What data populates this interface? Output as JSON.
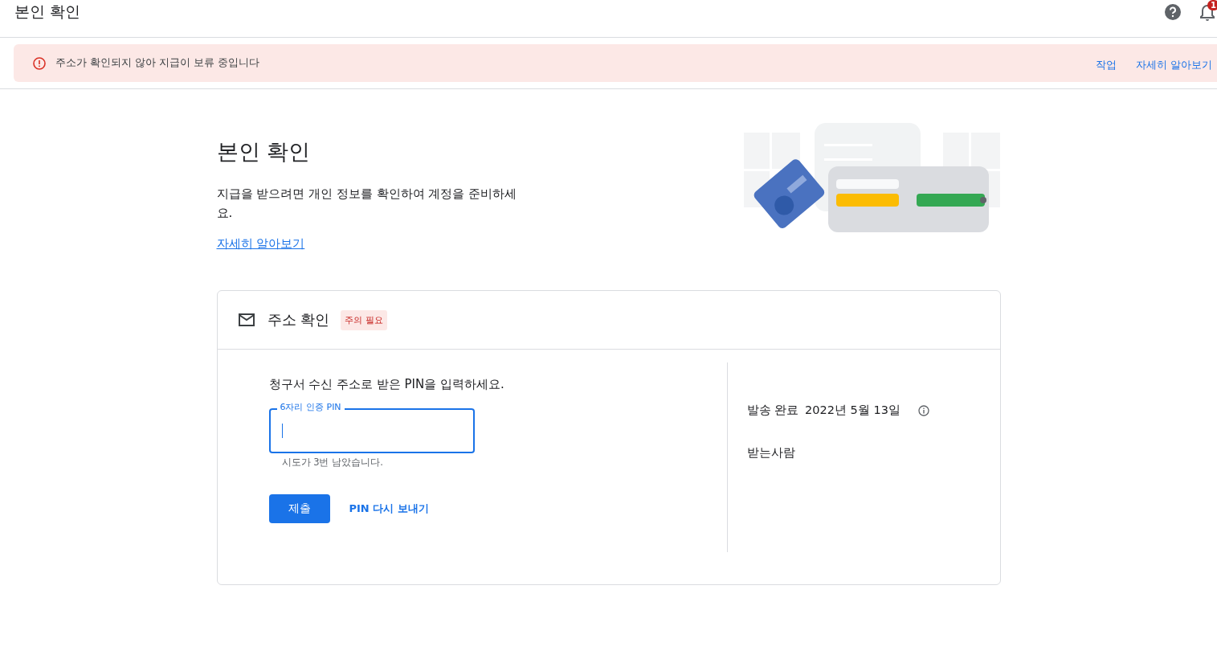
{
  "header": {
    "title": "본인 확인",
    "notification_count": "1"
  },
  "banner": {
    "message": "주소가 확인되지 않아 지급이 보류 중입니다",
    "actions": [
      "작업",
      "자세히 알아보기"
    ]
  },
  "intro": {
    "title": "본인 확인",
    "description": "지급을 받으려면 개인 정보를 확인하여 계정을 준비하세요.",
    "link": "자세히 알아보기"
  },
  "card": {
    "title": "주소 확인",
    "badge": "주의 필요",
    "instruction": "청구서 수신 주소로 받은 PIN을 입력하세요.",
    "pin_field": {
      "label": "6자리 인증 PIN",
      "focused": true,
      "helper": "시도가 3번 남았습니다."
    },
    "submit": "제출",
    "resend": "PIN 다시 보내기",
    "sent_label": "발송 완료",
    "sent_date": "2022년 5월 13일",
    "recipient_label": "받는사람"
  }
}
